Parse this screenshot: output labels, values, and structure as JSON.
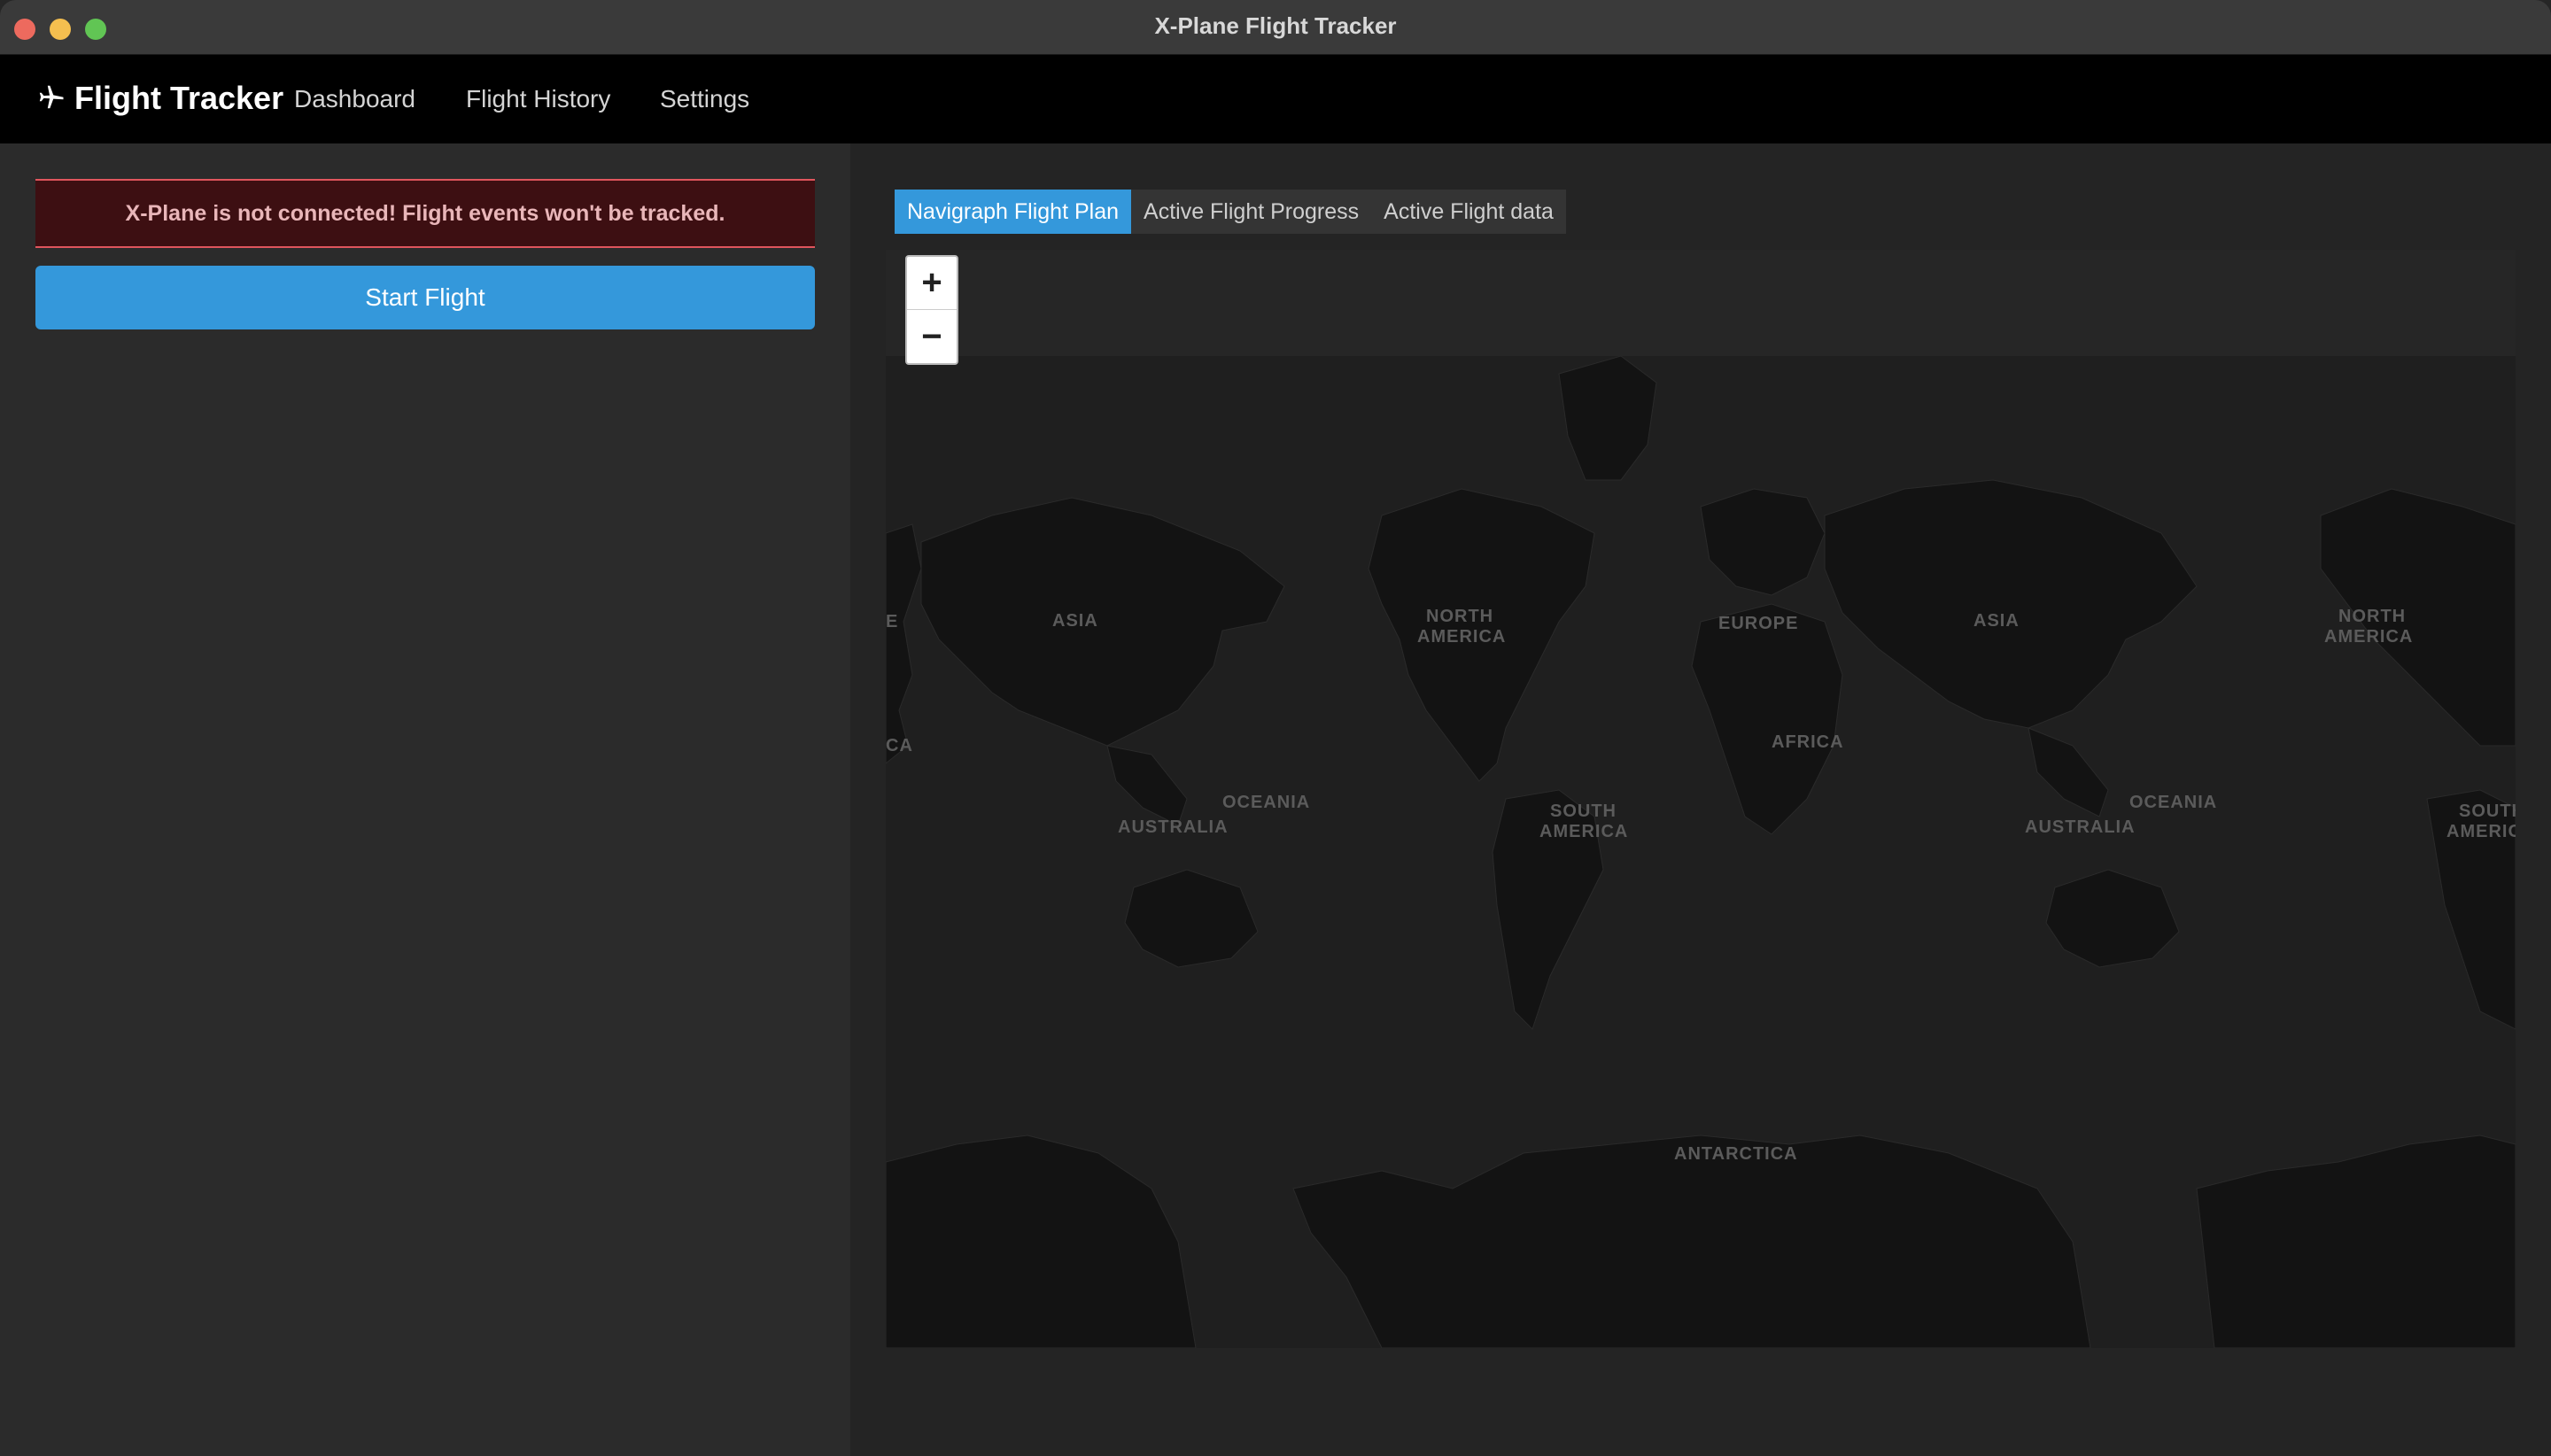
{
  "window": {
    "title": "X-Plane Flight Tracker"
  },
  "navbar": {
    "brand": "Flight Tracker",
    "brand_icon": "airplane-icon",
    "links": [
      "Dashboard",
      "Flight History",
      "Settings"
    ]
  },
  "left": {
    "alert_text": "X-Plane is not connected! Flight events won't be tracked.",
    "start_button": "Start Flight"
  },
  "tabs": [
    {
      "label": "Navigraph Flight Plan",
      "active": true
    },
    {
      "label": "Active Flight Progress",
      "active": false
    },
    {
      "label": "Active Flight data",
      "active": false
    }
  ],
  "map": {
    "zoom_in": "+",
    "zoom_out": "−",
    "labels": {
      "asia": "ASIA",
      "north": "NORTH",
      "america": "AMERICA",
      "europe": "EUROPE",
      "africa": "AFRICA",
      "oceania": "OCEANIA",
      "australia": "AUSTRALIA",
      "south": "SOUTH",
      "antarctica": "ANTARCTICA",
      "ca_fragment": "CA",
      "e_fragment": "E",
      "south_fragment": "SOUTH",
      "americ_fragment": "AMERIC"
    }
  },
  "colors": {
    "accent": "#3498db",
    "alert_bg": "#3d0f12",
    "alert_border": "#e0555d",
    "land": "#131313",
    "water": "#262626"
  }
}
